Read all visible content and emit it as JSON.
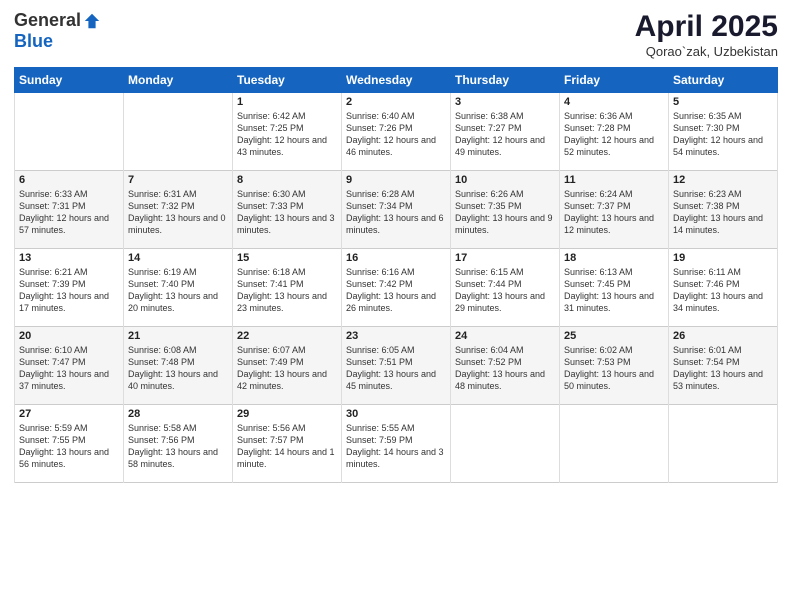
{
  "logo": {
    "general": "General",
    "blue": "Blue"
  },
  "title": "April 2025",
  "subtitle": "Qorao`zak, Uzbekistan",
  "days": [
    "Sunday",
    "Monday",
    "Tuesday",
    "Wednesday",
    "Thursday",
    "Friday",
    "Saturday"
  ],
  "weeks": [
    [
      {
        "day": "",
        "text": ""
      },
      {
        "day": "",
        "text": ""
      },
      {
        "day": "1",
        "text": "Sunrise: 6:42 AM\nSunset: 7:25 PM\nDaylight: 12 hours and 43 minutes."
      },
      {
        "day": "2",
        "text": "Sunrise: 6:40 AM\nSunset: 7:26 PM\nDaylight: 12 hours and 46 minutes."
      },
      {
        "day": "3",
        "text": "Sunrise: 6:38 AM\nSunset: 7:27 PM\nDaylight: 12 hours and 49 minutes."
      },
      {
        "day": "4",
        "text": "Sunrise: 6:36 AM\nSunset: 7:28 PM\nDaylight: 12 hours and 52 minutes."
      },
      {
        "day": "5",
        "text": "Sunrise: 6:35 AM\nSunset: 7:30 PM\nDaylight: 12 hours and 54 minutes."
      }
    ],
    [
      {
        "day": "6",
        "text": "Sunrise: 6:33 AM\nSunset: 7:31 PM\nDaylight: 12 hours and 57 minutes."
      },
      {
        "day": "7",
        "text": "Sunrise: 6:31 AM\nSunset: 7:32 PM\nDaylight: 13 hours and 0 minutes."
      },
      {
        "day": "8",
        "text": "Sunrise: 6:30 AM\nSunset: 7:33 PM\nDaylight: 13 hours and 3 minutes."
      },
      {
        "day": "9",
        "text": "Sunrise: 6:28 AM\nSunset: 7:34 PM\nDaylight: 13 hours and 6 minutes."
      },
      {
        "day": "10",
        "text": "Sunrise: 6:26 AM\nSunset: 7:35 PM\nDaylight: 13 hours and 9 minutes."
      },
      {
        "day": "11",
        "text": "Sunrise: 6:24 AM\nSunset: 7:37 PM\nDaylight: 13 hours and 12 minutes."
      },
      {
        "day": "12",
        "text": "Sunrise: 6:23 AM\nSunset: 7:38 PM\nDaylight: 13 hours and 14 minutes."
      }
    ],
    [
      {
        "day": "13",
        "text": "Sunrise: 6:21 AM\nSunset: 7:39 PM\nDaylight: 13 hours and 17 minutes."
      },
      {
        "day": "14",
        "text": "Sunrise: 6:19 AM\nSunset: 7:40 PM\nDaylight: 13 hours and 20 minutes."
      },
      {
        "day": "15",
        "text": "Sunrise: 6:18 AM\nSunset: 7:41 PM\nDaylight: 13 hours and 23 minutes."
      },
      {
        "day": "16",
        "text": "Sunrise: 6:16 AM\nSunset: 7:42 PM\nDaylight: 13 hours and 26 minutes."
      },
      {
        "day": "17",
        "text": "Sunrise: 6:15 AM\nSunset: 7:44 PM\nDaylight: 13 hours and 29 minutes."
      },
      {
        "day": "18",
        "text": "Sunrise: 6:13 AM\nSunset: 7:45 PM\nDaylight: 13 hours and 31 minutes."
      },
      {
        "day": "19",
        "text": "Sunrise: 6:11 AM\nSunset: 7:46 PM\nDaylight: 13 hours and 34 minutes."
      }
    ],
    [
      {
        "day": "20",
        "text": "Sunrise: 6:10 AM\nSunset: 7:47 PM\nDaylight: 13 hours and 37 minutes."
      },
      {
        "day": "21",
        "text": "Sunrise: 6:08 AM\nSunset: 7:48 PM\nDaylight: 13 hours and 40 minutes."
      },
      {
        "day": "22",
        "text": "Sunrise: 6:07 AM\nSunset: 7:49 PM\nDaylight: 13 hours and 42 minutes."
      },
      {
        "day": "23",
        "text": "Sunrise: 6:05 AM\nSunset: 7:51 PM\nDaylight: 13 hours and 45 minutes."
      },
      {
        "day": "24",
        "text": "Sunrise: 6:04 AM\nSunset: 7:52 PM\nDaylight: 13 hours and 48 minutes."
      },
      {
        "day": "25",
        "text": "Sunrise: 6:02 AM\nSunset: 7:53 PM\nDaylight: 13 hours and 50 minutes."
      },
      {
        "day": "26",
        "text": "Sunrise: 6:01 AM\nSunset: 7:54 PM\nDaylight: 13 hours and 53 minutes."
      }
    ],
    [
      {
        "day": "27",
        "text": "Sunrise: 5:59 AM\nSunset: 7:55 PM\nDaylight: 13 hours and 56 minutes."
      },
      {
        "day": "28",
        "text": "Sunrise: 5:58 AM\nSunset: 7:56 PM\nDaylight: 13 hours and 58 minutes."
      },
      {
        "day": "29",
        "text": "Sunrise: 5:56 AM\nSunset: 7:57 PM\nDaylight: 14 hours and 1 minute."
      },
      {
        "day": "30",
        "text": "Sunrise: 5:55 AM\nSunset: 7:59 PM\nDaylight: 14 hours and 3 minutes."
      },
      {
        "day": "",
        "text": ""
      },
      {
        "day": "",
        "text": ""
      },
      {
        "day": "",
        "text": ""
      }
    ]
  ]
}
